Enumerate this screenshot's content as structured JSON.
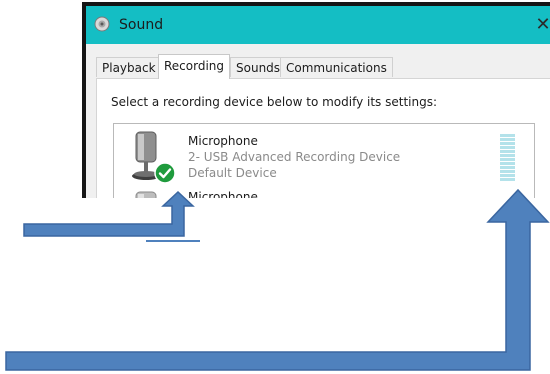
{
  "window": {
    "title": "Sound",
    "close_glyph": "✕",
    "title_icon": "speaker-icon"
  },
  "tabs": [
    {
      "label": "Playback",
      "active": false
    },
    {
      "label": "Recording",
      "active": true
    },
    {
      "label": "Sounds",
      "active": false
    },
    {
      "label": "Communications",
      "active": false
    }
  ],
  "recording": {
    "instruction": "Select a recording device below to modify its settings:",
    "devices": [
      {
        "name": "Microphone",
        "description": "2- USB Advanced Recording Device",
        "status": "Default Device",
        "default": true
      },
      {
        "name": "Microphone",
        "description": "",
        "status": "",
        "default": false
      }
    ]
  },
  "colors": {
    "titlebar": "#14bec4",
    "arrow": "#4f81bd",
    "arrow_outline": "#3a66a0",
    "check": "#1f9b3d",
    "meter": "#b4e2ea"
  }
}
